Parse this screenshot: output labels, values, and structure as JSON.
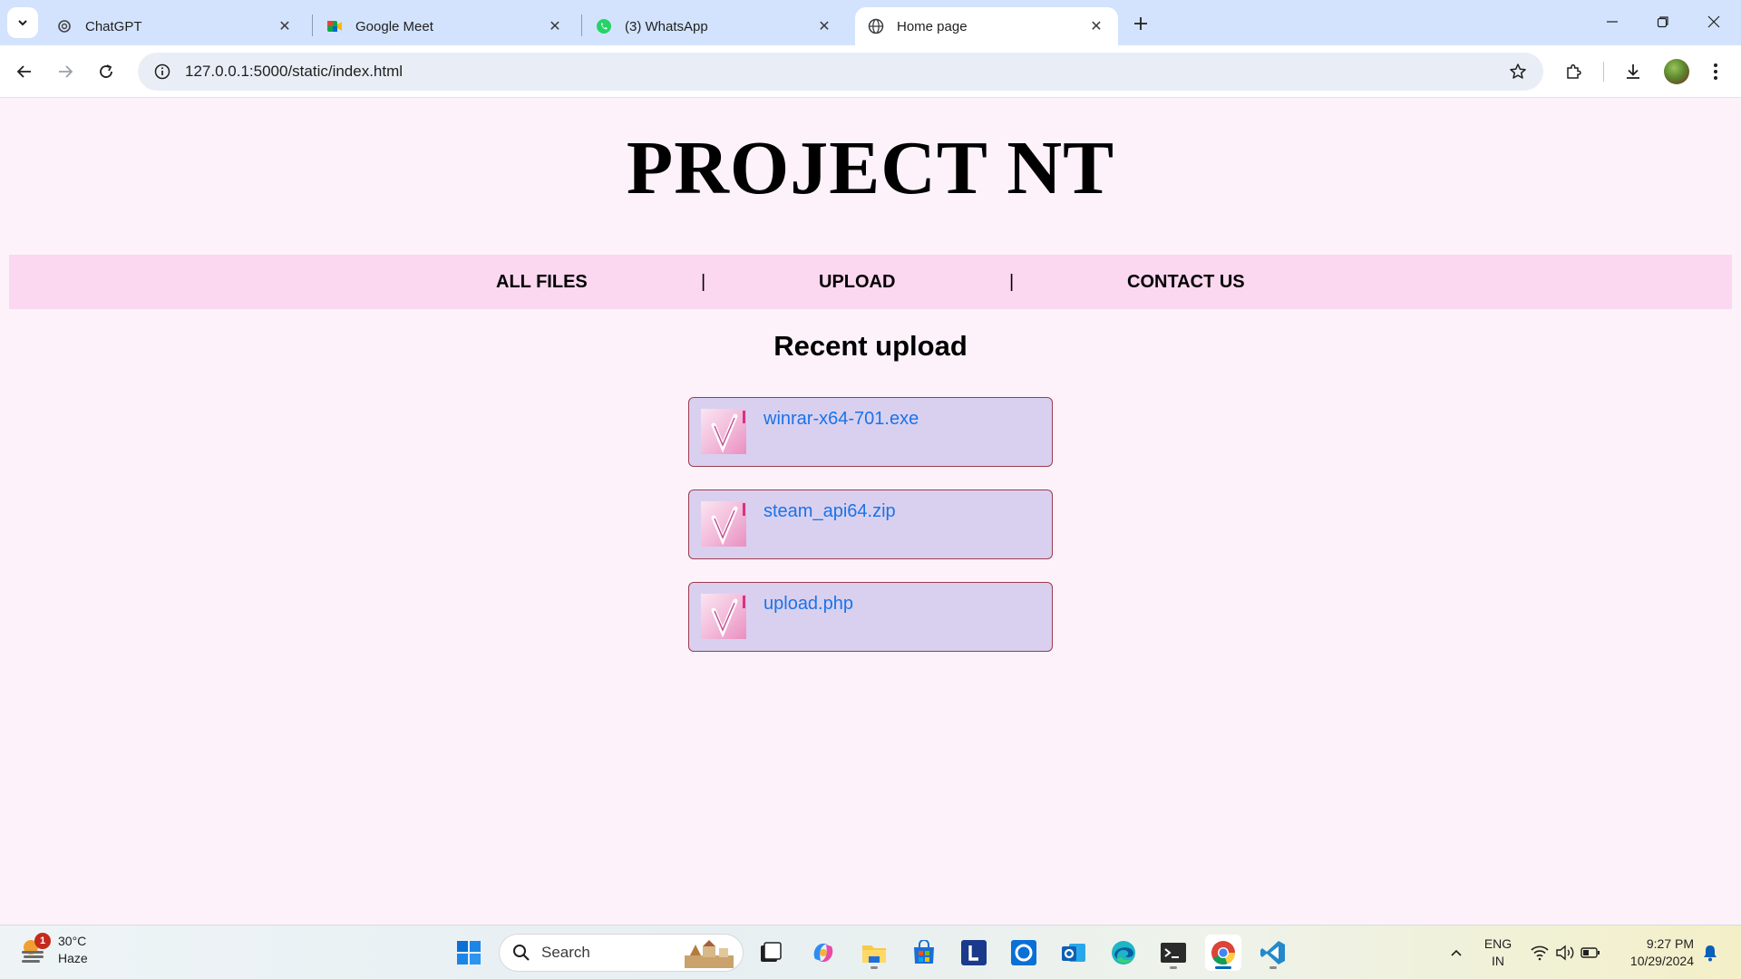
{
  "browser": {
    "tabs": [
      {
        "title": "ChatGPT",
        "icon": "chatgpt-icon"
      },
      {
        "title": "Google Meet",
        "icon": "google-meet-icon"
      },
      {
        "title": "(3) WhatsApp",
        "icon": "whatsapp-icon"
      },
      {
        "title": "Home page",
        "icon": "globe-icon",
        "active": true
      }
    ],
    "url": "127.0.0.1:5000/static/index.html"
  },
  "page": {
    "title": "PROJECT NT",
    "nav": {
      "all_files": "ALL FILES",
      "upload": "UPLOAD",
      "contact": "CONTACT US",
      "separator": "|"
    },
    "section_title": "Recent upload",
    "files": [
      {
        "name": "winrar-x64-701.exe"
      },
      {
        "name": "steam_api64.zip"
      },
      {
        "name": "upload.php"
      }
    ]
  },
  "taskbar": {
    "weather": {
      "temp": "30°C",
      "condition": "Haze",
      "badge": "1"
    },
    "search_placeholder": "Search",
    "lang": {
      "line1": "ENG",
      "line2": "IN"
    },
    "clock": {
      "time": "9:27 PM",
      "date": "10/29/2024"
    }
  },
  "colors": {
    "page_bg": "#fdf2fa",
    "nav_bg": "#fbd7f0",
    "card_bg": "#d9d0f0",
    "card_border": "#9c3b4e",
    "link": "#1a73e8"
  }
}
